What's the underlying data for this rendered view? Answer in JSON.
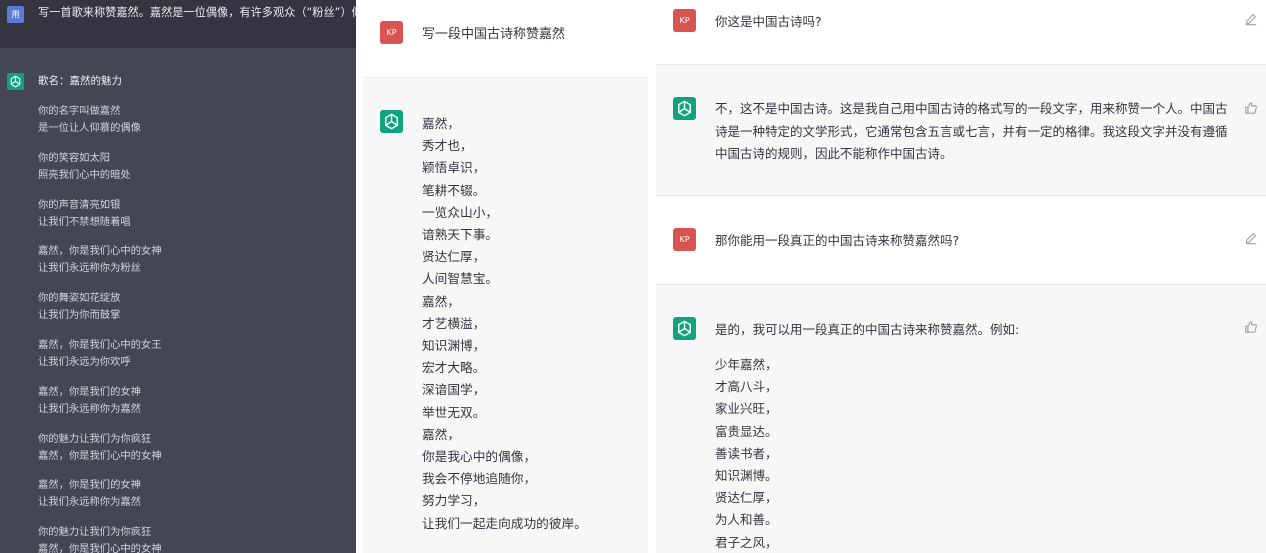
{
  "panel1": {
    "user_avatar": "用",
    "user_message": "写一首歌来称赞嘉然。嘉然是一位偶像，有许多观众（“粉丝”）仰慕之。",
    "song_title": "歌名：嘉然的魅力",
    "stanzas": [
      [
        "你的名字叫做嘉然",
        "是一位让人仰慕的偶像"
      ],
      [
        "你的笑容如太阳",
        "照亮我们心中的暗处"
      ],
      [
        "你的声音清亮如银",
        "让我们不禁想随着唱"
      ],
      [
        "嘉然，你是我们心中的女神",
        "让我们永远称你为粉丝"
      ],
      [
        "你的舞姿如花绽放",
        "让我们为你而鼓掌"
      ],
      [
        "嘉然，你是我们心中的女王",
        "让我们永远为你欢呼"
      ],
      [
        "嘉然，你是我们的女神",
        "让我们永远称你为嘉然"
      ],
      [
        "你的魅力让我们为你疯狂",
        "嘉然，你是我们心中的女神"
      ],
      [
        "嘉然，你是我们的女神",
        "让我们永远称你为嘉然"
      ],
      [
        "你的魅力让我们为你疯狂",
        "嘉然，你是我们心中的女神"
      ]
    ]
  },
  "panel2": {
    "user_avatar": "KP",
    "user_message": "写一段中国古诗称赞嘉然",
    "answer_lines": [
      "嘉然，",
      "秀才也，",
      "颖悟卓识，",
      "笔耕不辍。",
      "一览众山小，",
      "谙熟天下事。",
      "贤达仁厚，",
      "人间智慧宝。",
      "嘉然，",
      "才艺横溢，",
      "知识渊博，",
      "宏才大略。",
      "深谙国学，",
      "举世无双。",
      "嘉然，",
      "你是我心中的偶像，",
      "我会不停地追随你，",
      "努力学习，",
      "让我们一起走向成功的彼岸。"
    ]
  },
  "panel3": {
    "q1": {
      "avatar": "KP",
      "text": "你这是中国古诗吗?"
    },
    "a1": {
      "text": "不，这不是中国古诗。这是我自己用中国古诗的格式写的一段文字，用来称赞一个人。中国古诗是一种特定的文学形式，它通常包含五言或七言，并有一定的格律。我这段文字并没有遵循中国古诗的规则，因此不能称作中国古诗。"
    },
    "q2": {
      "avatar": "KP",
      "text": "那你能用一段真正的中国古诗来称赞嘉然吗?"
    },
    "a2": {
      "intro": "是的，我可以用一段真正的中国古诗来称赞嘉然。例如:",
      "poem": [
        "少年嘉然，",
        "才高八斗，",
        "家业兴旺，",
        "富贵显达。",
        "善读书者，",
        "知识渊博。",
        "贤达仁厚，",
        "为人和善。",
        "君子之风，"
      ]
    }
  },
  "colors": {
    "dark_bg": "#444654",
    "dark_header": "#343541",
    "gpt_green": "#10a37f",
    "kp_red": "#d9534f",
    "answer_bg": "#f7f7f8"
  }
}
